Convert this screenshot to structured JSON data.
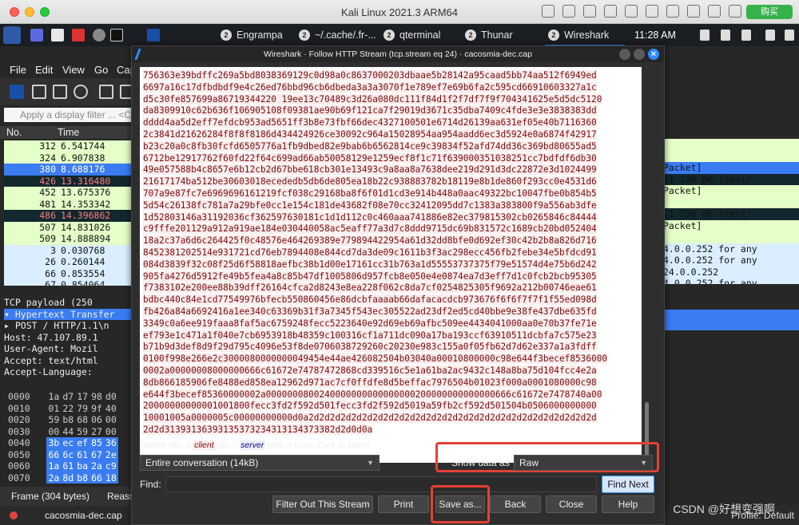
{
  "mac": {
    "title": "Kali Linux 2021.3 ARM64",
    "purchase": "购买"
  },
  "taskbar": {
    "tasks": [
      {
        "label": "Engrampa",
        "badge": "2"
      },
      {
        "label": "~/.cache/.fr-...",
        "badge": "2"
      },
      {
        "label": "qterminal",
        "badge": "2"
      },
      {
        "label": "Thunar",
        "badge": "2"
      },
      {
        "label": "Wireshark",
        "badge": "2"
      }
    ],
    "clock": "11:28 AM"
  },
  "wireshark": {
    "menu": [
      "File",
      "Edit",
      "View",
      "Go",
      "Cap"
    ],
    "filter_placeholder": "Apply a display filter ... <C",
    "columns": {
      "no": "No.",
      "time": "Time"
    },
    "packets": [
      {
        "no": "312",
        "time": "6.541744"
      },
      {
        "no": "324",
        "time": "6.907838"
      },
      {
        "no": "380",
        "time": "8.688176"
      },
      {
        "no": "426",
        "time": "13.316480"
      },
      {
        "no": "452",
        "time": "13.675376"
      },
      {
        "no": "481",
        "time": "14.353342"
      },
      {
        "no": "486",
        "time": "14.396862"
      },
      {
        "no": "507",
        "time": "14.831026"
      },
      {
        "no": "509",
        "time": "14.888894"
      },
      {
        "no": "3",
        "time": "0.030768"
      },
      {
        "no": "26",
        "time": "0.260144"
      },
      {
        "no": "66",
        "time": "0.853554"
      },
      {
        "no": "67",
        "time": "0.854064"
      }
    ],
    "right_info": [
      {
        "text": "Packet]",
        "row": 2
      },
      {
        "text": ".1 200 OK  (text/",
        "row": 3
      },
      {
        "text": "Packet]",
        "row": 4
      },
      {
        "text": ".1 200 OK  (text/",
        "row": 6
      },
      {
        "text": "Packet]",
        "row": 7
      },
      {
        "text": "4.0.0.252 for any",
        "row": 9
      },
      {
        "text": "4.0.0.252 for any",
        "row": 10
      },
      {
        "text": "24.0.0.252",
        "row": 11
      },
      {
        "text": "4.0.0.252 for any",
        "row": 12
      }
    ],
    "details": [
      "  TCP payload (250",
      "▾ Hypertext Transfer",
      "  ▸ POST / HTTP/1.1\\n",
      "    Host: 47.107.89.1",
      "    User-Agent: Mozil",
      "    Accept: text/html",
      "    Accept-Language:"
    ],
    "hex_rows": [
      {
        "offset": "0000",
        "bytes": [
          "1a",
          "d7",
          "17",
          "98",
          "d0"
        ]
      },
      {
        "offset": "0010",
        "bytes": [
          "01",
          "22",
          "79",
          "9f",
          "40"
        ]
      },
      {
        "offset": "0020",
        "bytes": [
          "59",
          "b8",
          "68",
          "06",
          "00"
        ]
      },
      {
        "offset": "0030",
        "bytes": [
          "00",
          "44",
          "59",
          "27",
          "00"
        ]
      },
      {
        "offset": "0040",
        "bytes": [
          "3b",
          "ec",
          "ef",
          "85",
          "36"
        ]
      },
      {
        "offset": "0050",
        "bytes": [
          "66",
          "6c",
          "61",
          "67",
          "2e"
        ]
      },
      {
        "offset": "0060",
        "bytes": [
          "1a",
          "61",
          "ba",
          "2a",
          "c9"
        ]
      },
      {
        "offset": "0070",
        "bytes": [
          "2a",
          "8d",
          "b8",
          "66",
          "18"
        ]
      }
    ],
    "status_tabs": {
      "frame": "Frame (304 bytes)",
      "reass": "Reass"
    },
    "status_file": "cacosmia-dec.cap",
    "profile": "Profile: Default"
  },
  "dialog": {
    "title": "Wireshark · Follow HTTP Stream (tcp.stream eq 24) · cacosmia-dec.cap",
    "stream_lines": [
      "756363e39bdffc269a5bd8038369129c0d98a0c8637000203dbaae5b28142a95caad5bb74aa512f6949ed",
      "6697a16c17dfbdbdf9e4c26ed76bbd96cb6dbeda3a3a3070f1e789ef7e69b6fa2c595cd66910603327a1c",
      "d5c30fe857699a86719344220 19ee13c70489c3d26a080dc111f84d1f2f7df7f9f704341625e5d5dc5120",
      "da8309910c62b636f106905108f09381ae90b69f121ca7f29019d3671c35dba7409c4fde3e3e3838383dd",
      "dddd4aa5d2eff7efdcb953ad5651ff3b8e73fbf66dec4327100501e6714d26139aa631ef05e40b7116360",
      "2c3841d21626284f8f8f8186d434424926ce30092c964a15028954aa954aadd6ec3d5924e0a6874f42917",
      "b23c20a0c8fb30fcfd6505776a1fb9dbed82e9bab6b6562814ce9c39834f52afd74dd36c369bd80655ad5",
      "6712be12917762f60fd22f64c699ad66ab50058129e1259ecf8f1c71f639000351038251cc7bdfdf6db30",
      "49e057588b4c8657e6b12cb2d67bbe618cb301e13493c9a8aa8a7638dee219d291d3dc22872e3d1024499",
      "21617174ba512be30603018ecededb5db6de805ea18b22c938883782b18119e8b1de860f293cc0e4531d6",
      "707a9e87fc7e6969696161219fcf038c29168ba8f6f01d1cd3e914b448a0aac49322bc10047fbe0b854b5",
      "5d54c26138fc781a7a29bfe0cc1e154c181de43682f08e70cc32412095dd7c1383a383800f9a556ab3dfe",
      "1d52803146a31192036cf362597630181c1d1d112c0c460aaa741886e82ec379815302cb0265846c84444",
      "c9fffe201129a912a919ae184e030440058ac5eaff77a3d7c8ddd9715dc69b831572c1689cb20bd052404",
      "18a2c37a6d6c264425f0c48576e464269389e779894422954a61d32dd8bfe0d692ef30c42b2b8a826d716",
      "8452381202514e931721cd76eb7894408e844cd7da3de09c1611b3f3ac298ecc456fb2febe34e5bfdcd91",
      "084d3839f32c08f25d6f58818aefbc38b1d00e17161cc31b763a1d55553737375f79e51574d4e75b6d242",
      "905fa4276d5912fe49b5fea4a8c85b47df1005806d957fcb8e050e4e0874ea7d3eff7d1c0fcb2bcb95305",
      "f7383102e200ee88b39dff26164cfca2d8243e8ea228f062c8da7cf0254825305f9692a212b00746eae61",
      "bdbc440c84e1cd77549976bfecb550860456e86dcbfaaaab66dafacacdcb973676f6f6f7f7f1f55ed098d",
      "fb426a84a6692416a1ee340c63369b31f3a7345f543ec305522ad23df2ed5cd40bbe9e38fe437dbe635fd",
      "3349c0a6ee919faaa8faf5ac6759248fecc5223640e92d69eb69afbc509ee4434041000aa0e70b37fe71e",
      "ef793e1c471a1f040e7cb6953918b48359c100316cf1a711dc090a17ba193ccf63910511dcbfa7c575e23",
      "b71b9d3def8d9f29d795c4096e53f8de0706038729260c20230e983c155a0f05fb62d7d62e337a1a3fdff",
      "0100f998e266e2c3000080000000049454e44ae426082504b03040a00010800000c98e644f3becef8536000",
      "0002a00000008000000666c61672e74787472868cd339516c5e1a61ba2ac9432c148a8ba75d104fcc4e2a",
      "8db866185906fe8488ed858ea12962d971ac7cf0ffdfe8d5beffac7976504b01023f000a0001080000c98",
      "e644f3becef85360000002a0000000800240000000000000000200000000000000666c61672e7478740a00",
      "20000000000001001800fecc3fd2f592d501fecc3fd2f592d5019a59fb2cf592d501504b0506000000000",
      "10001005a0000005c00000000000d0a2d2d2d2d2d2d2d2d2d2d2d2d2d2d2d2d2d2d2d2d2d2d2d2d2d2d2d",
      "2d2d31393136393135373234313134373382d2d0d0a"
    ],
    "packet_info": {
      "prefix": "Packet 380. 1 ",
      "client": "client",
      "mid": " pkt, 0 ",
      "server": "server",
      "suffix": " pkts, 0 turns. Click to select."
    },
    "conversation": "Entire conversation (14kB)",
    "show_data_label": "Show data as",
    "show_data_value": "Raw",
    "find_label": "Find:",
    "find_value": "",
    "buttons": {
      "find_next": "Find Next",
      "filter_out": "Filter Out This Stream",
      "print": "Print",
      "save_as": "Save as...",
      "back": "Back",
      "close": "Close",
      "help": "Help"
    }
  },
  "watermark": "CSDN @好想变强啊",
  "colors": {
    "client_bg": "#fbeded",
    "client_fg": "#7a0c0c",
    "highlight_box": "#e64035",
    "selection": "#3a7cf2"
  }
}
